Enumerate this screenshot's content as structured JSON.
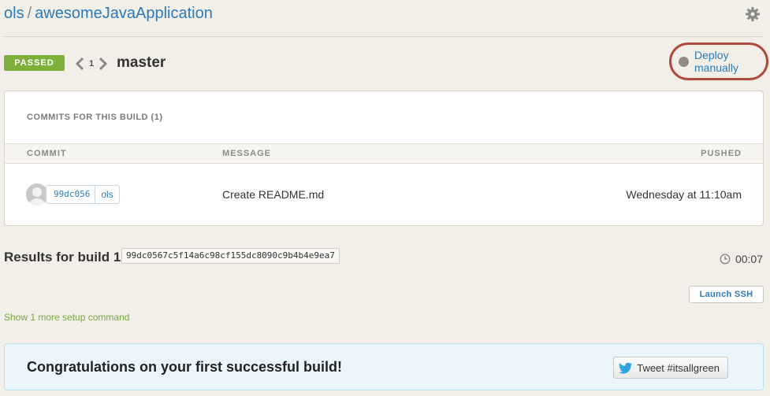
{
  "breadcrumb": {
    "owner": "ols",
    "separator": "/",
    "repo": "awesomeJavaApplication"
  },
  "build": {
    "status": "PASSED",
    "number": "1",
    "branch": "master"
  },
  "deploy": {
    "label": "Deploy manually"
  },
  "commits": {
    "title": "COMMITS FOR THIS BUILD (1)",
    "headers": {
      "commit": "COMMIT",
      "message": "MESSAGE",
      "pushed": "PUSHED"
    },
    "rows": [
      {
        "sha": "99dc056",
        "author": "ols",
        "message": "Create README.md",
        "pushed": "Wednesday at 11:10am"
      }
    ]
  },
  "results": {
    "title": "Results for build 1",
    "hash": "99dc0567c5f14a6c98cf155dc8090c9b4b4e9ea7",
    "duration": "00:07"
  },
  "actions": {
    "launch_ssh": "Launch SSH",
    "setup_link": "Show 1 more setup command"
  },
  "congrats": {
    "text": "Congratulations on your first successful build!",
    "tweet": "Tweet #itsallgreen"
  },
  "colors": {
    "passed": "#7fb03c",
    "link": "#2c7ab8",
    "highlight": "#b04a3c",
    "background": "#f1efe8"
  },
  "icons": [
    "gear-icon",
    "chevron-left-icon",
    "chevron-right-icon",
    "status-dot-icon",
    "avatar-icon",
    "clock-icon",
    "twitter-bird-icon"
  ]
}
